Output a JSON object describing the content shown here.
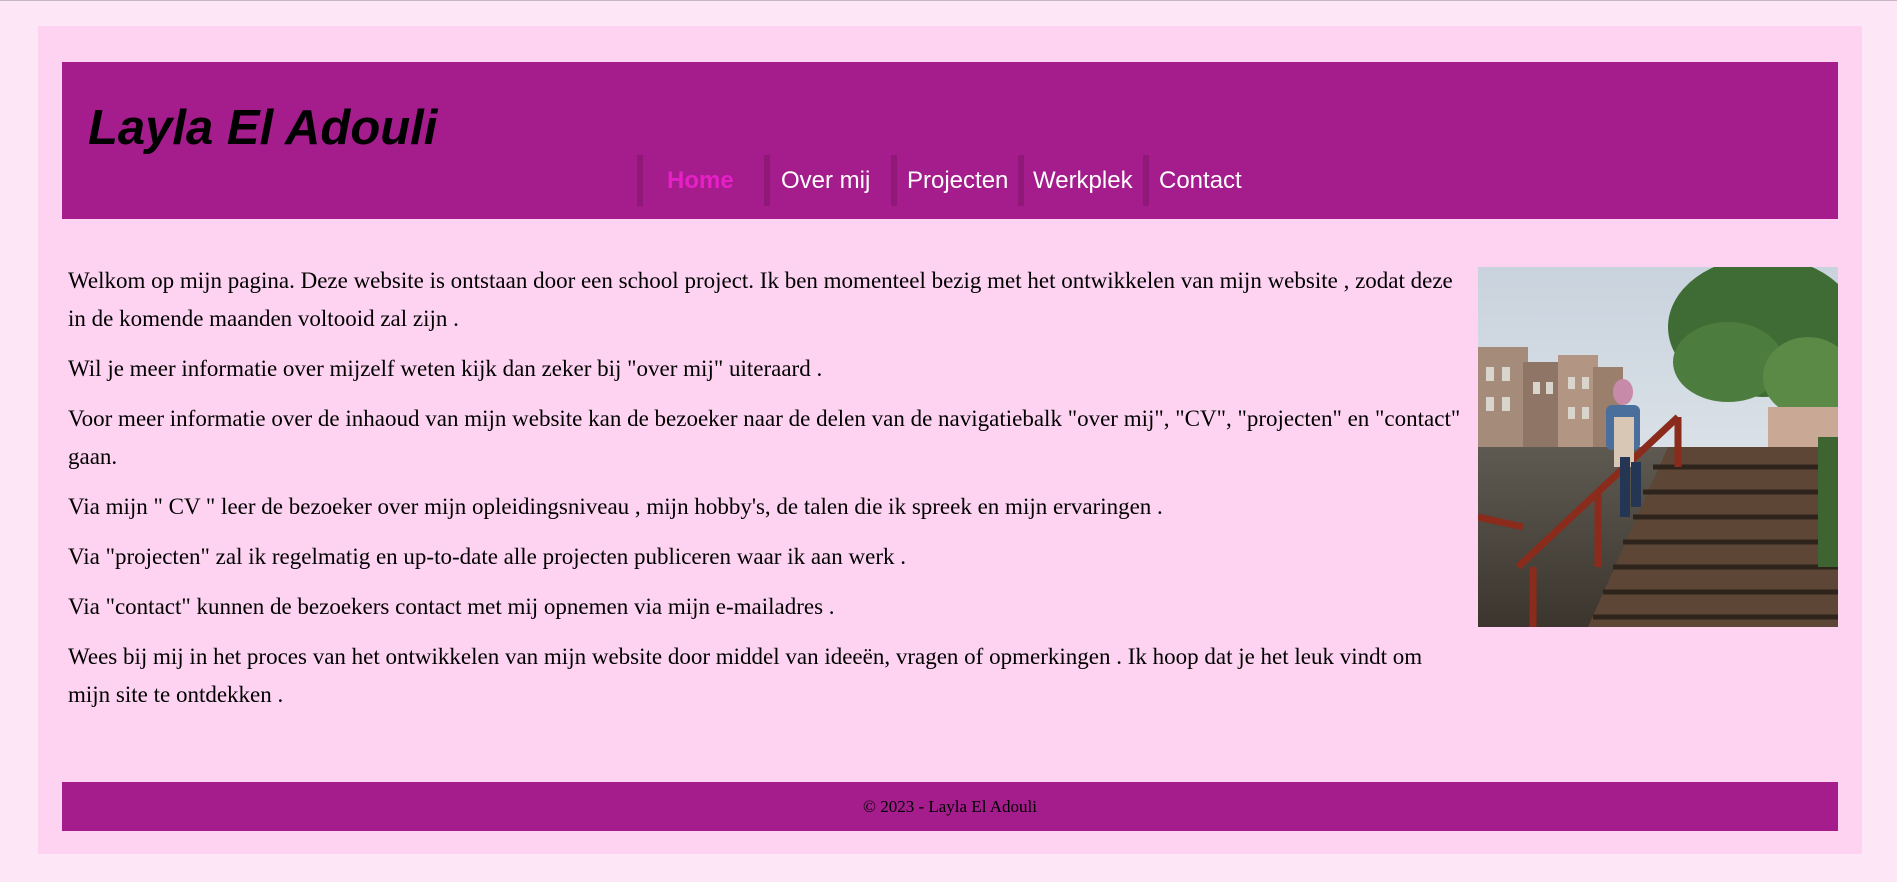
{
  "header": {
    "title": "Layla El Adouli"
  },
  "nav": {
    "items": [
      {
        "label": "Home",
        "active": true
      },
      {
        "label": "Over mij",
        "active": false
      },
      {
        "label": "Projecten",
        "active": false
      },
      {
        "label": "Werkplek",
        "active": false
      },
      {
        "label": "Contact",
        "active": false
      }
    ]
  },
  "main": {
    "paragraphs": [
      "Welkom op mijn pagina. Deze website is ontstaan door een school project. Ik ben momenteel bezig met het ontwikkelen van mijn website , zodat deze in de komende maanden voltooid zal zijn .",
      "Wil je meer informatie over mijzelf weten kijk dan zeker bij \"over mij\" uiteraard .",
      "Voor meer informatie over de inhaoud van mijn website kan de bezoeker naar de delen van de navigatiebalk \"over mij\", \"CV\", \"projecten\" en \"contact\" gaan.",
      "Via mijn \" CV \" leer de bezoeker over mijn opleidingsniveau , mijn hobby's, de talen die ik spreek en mijn ervaringen .",
      "Via \"projecten\" zal ik regelmatig en up-to-date alle projecten publiceren waar ik aan werk .",
      "Via \"contact\" kunnen de bezoekers contact met mij opnemen via mijn e-mailadres .",
      "Wees bij mij in het proces van het ontwikkelen van mijn website door middel van ideeën, vragen of opmerkingen . Ik hoop dat je het leuk vindt om mijn site te ontdekken ."
    ]
  },
  "footer": {
    "text": "© 2023 - Layla El Adouli"
  },
  "colors": {
    "page_background": "#fde6f6",
    "content_background": "#fdd3f1",
    "header_footer": "#a51d8c",
    "nav_active": "#e61fc7",
    "nav_text": "#ffffff"
  }
}
